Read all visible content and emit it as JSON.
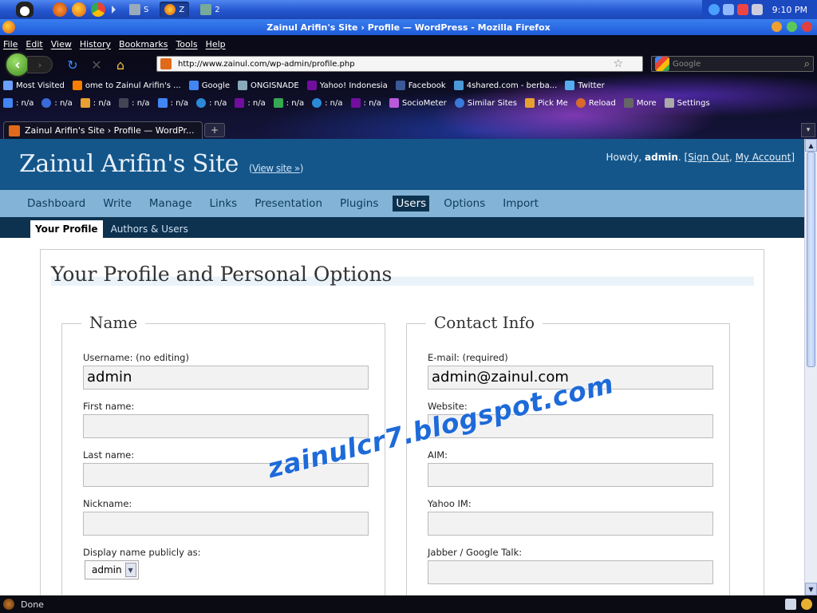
{
  "taskbar": {
    "tasks": [
      {
        "label": "S"
      },
      {
        "label": "Z"
      },
      {
        "label": "2"
      }
    ],
    "clock": "9:10 PM"
  },
  "browser": {
    "window_title": "Zainul Arifin's Site › Profile — WordPress - Mozilla Firefox",
    "menu": [
      "File",
      "Edit",
      "View",
      "History",
      "Bookmarks",
      "Tools",
      "Help"
    ],
    "url": "http://www.zainul.com/wp-admin/profile.php",
    "search_placeholder": "Google",
    "bookmarks": [
      "Most Visited",
      "ome to Zainul Arifin's ...",
      "Google",
      "ONGISNADE",
      "Yahoo! Indonesia",
      "Facebook",
      "4shared.com - berba...",
      "Twitter"
    ],
    "toolbar2": [
      ": n/a",
      ": n/a",
      ": n/a",
      ": n/a",
      ": n/a",
      ": n/a",
      ": n/a",
      ": n/a",
      ": n/a",
      ": n/a",
      "SocioMeter",
      "Similar Sites",
      "Pick Me",
      "Reload",
      "More",
      "Settings"
    ],
    "tab_title": "Zainul Arifin's Site › Profile — WordPr...",
    "new_tab": "+",
    "status": "Done"
  },
  "wp": {
    "site_title": "Zainul Arifin's Site",
    "view_site": "View site »",
    "howdy_prefix": "Howdy,",
    "user": "admin",
    "sign_out": "Sign Out",
    "my_account": "My Account",
    "menu": [
      "Dashboard",
      "Write",
      "Manage",
      "Links",
      "Presentation",
      "Plugins",
      "Users",
      "Options",
      "Import"
    ],
    "current_menu": "Users",
    "submenu": [
      "Your Profile",
      "Authors & Users"
    ],
    "page_title": "Your Profile and Personal Options",
    "name_section": {
      "legend": "Name",
      "username_label": "Username: (no editing)",
      "username_value": "admin",
      "first_name_label": "First name:",
      "first_name_value": "",
      "last_name_label": "Last name:",
      "last_name_value": "",
      "nickname_label": "Nickname:",
      "nickname_value": "",
      "display_label": "Display name publicly as:",
      "display_value": "admin"
    },
    "contact_section": {
      "legend": "Contact Info",
      "email_label": "E-mail: (required)",
      "email_value": "admin@zainul.com",
      "website_label": "Website:",
      "website_value": "",
      "aim_label": "AIM:",
      "aim_value": "",
      "yahoo_label": "Yahoo IM:",
      "yahoo_value": "",
      "jabber_label": "Jabber / Google Talk:",
      "jabber_value": ""
    }
  },
  "watermark": "zainulcr7.blogspot.com"
}
